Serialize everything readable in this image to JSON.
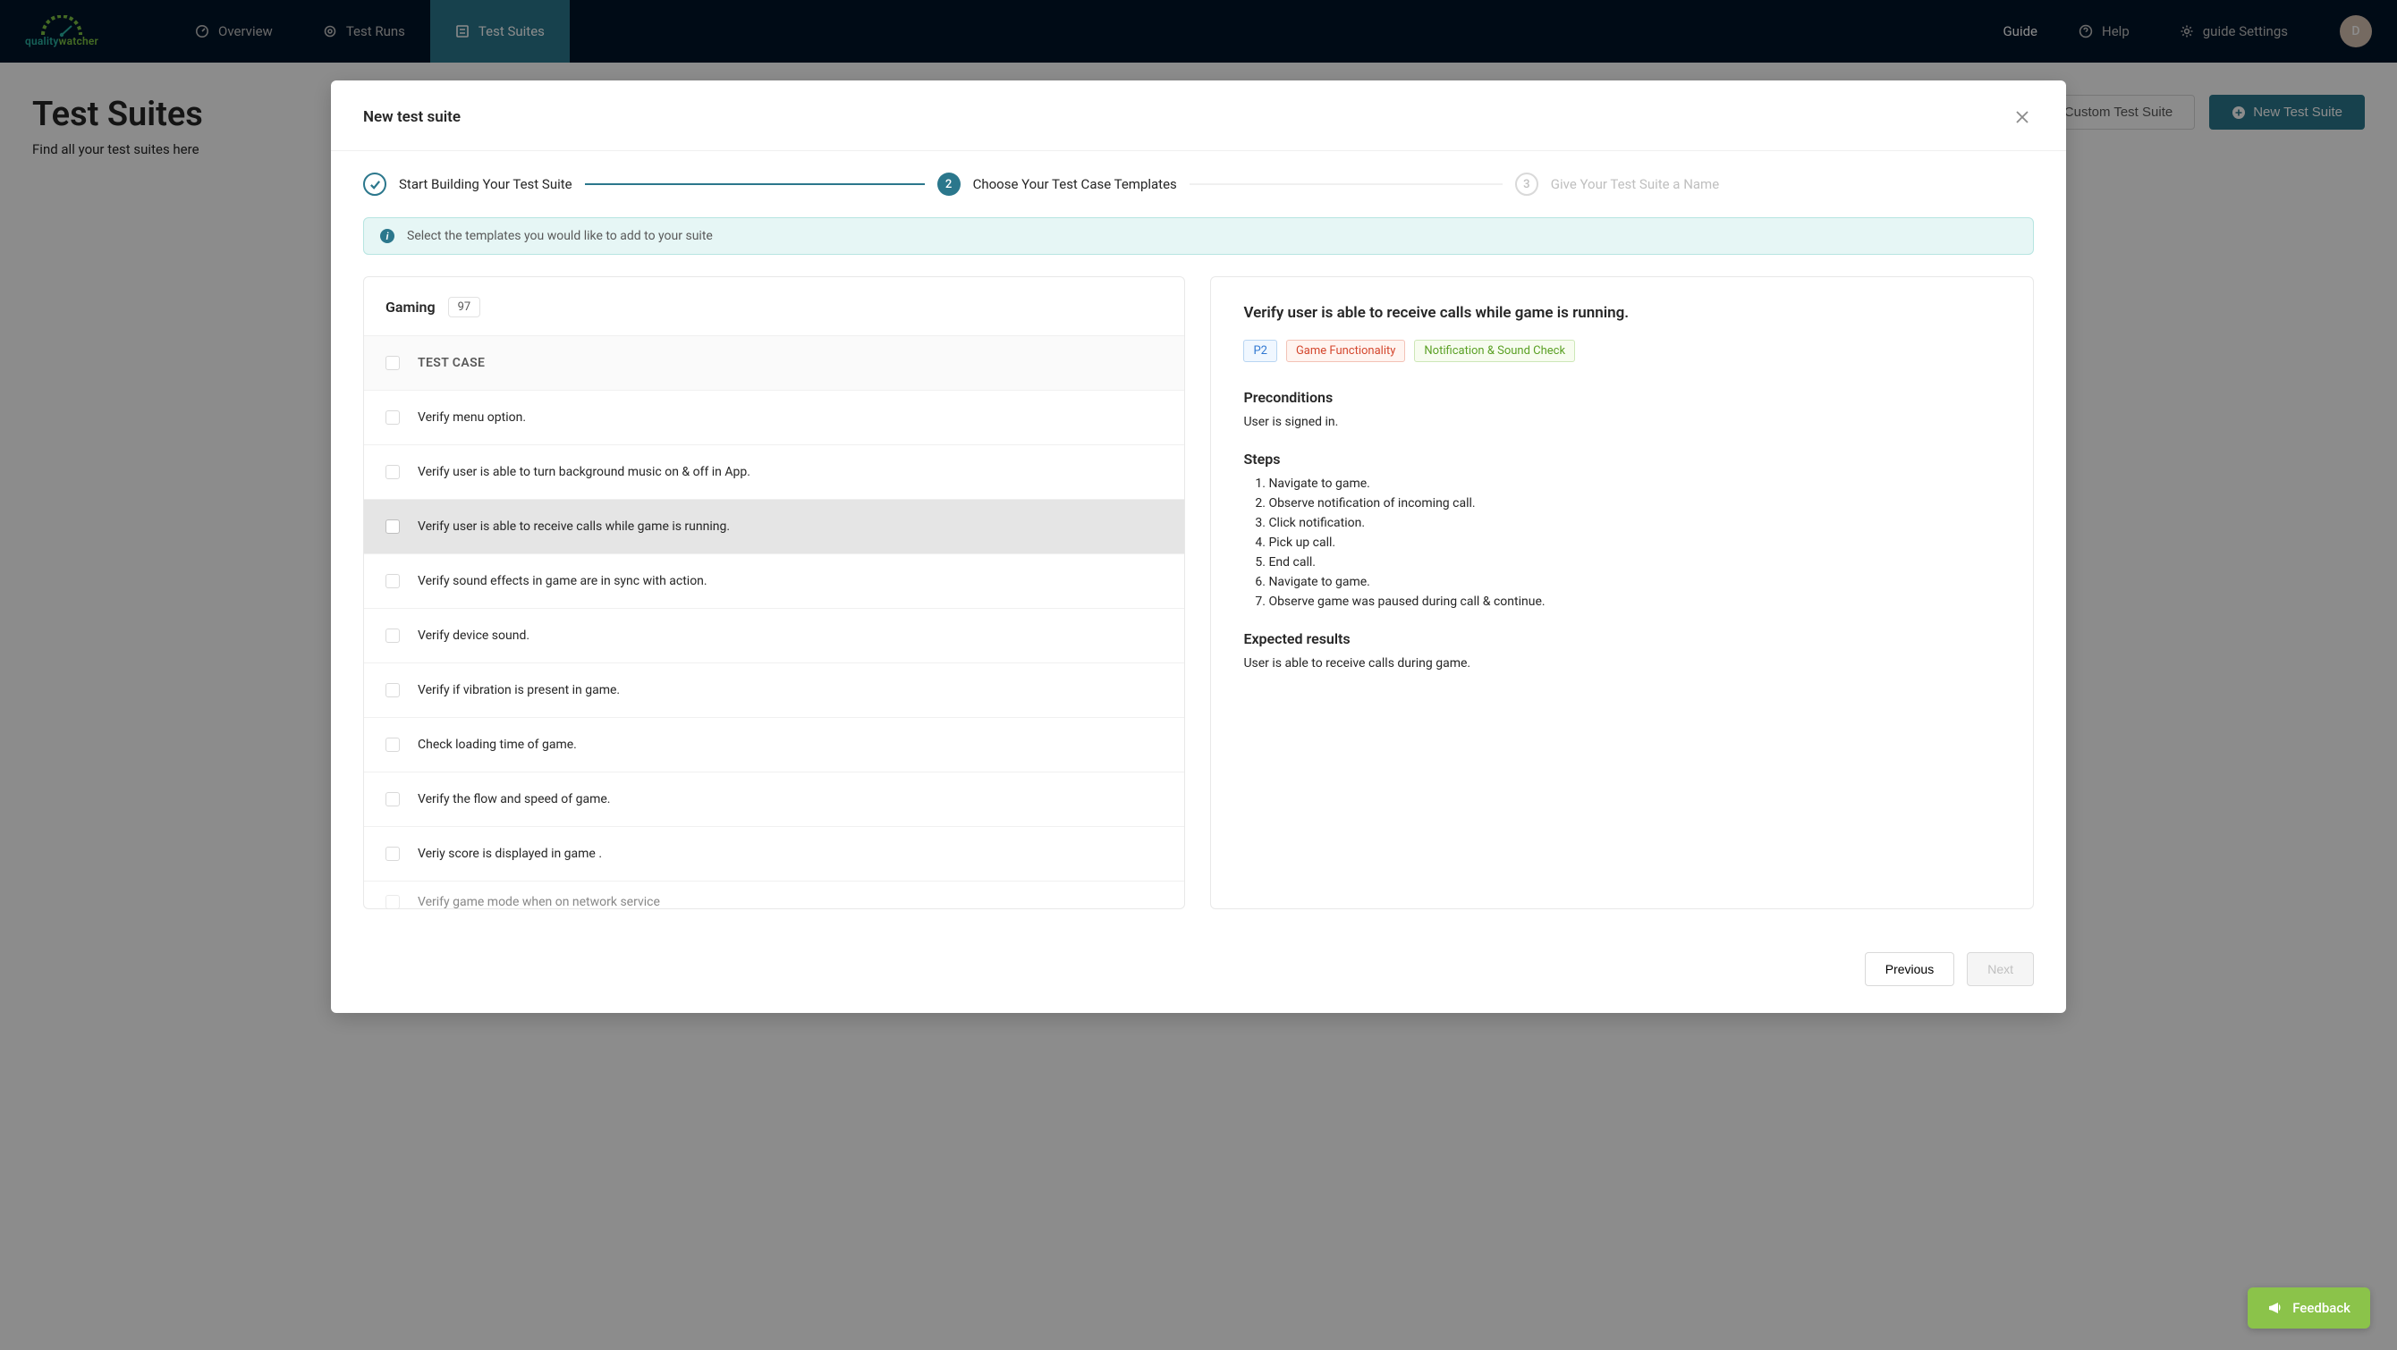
{
  "brand": {
    "name1": "quality",
    "name2": "watcher"
  },
  "nav": {
    "items": [
      {
        "label": "Overview",
        "active": false
      },
      {
        "label": "Test Runs",
        "active": false
      },
      {
        "label": "Test Suites",
        "active": true
      }
    ],
    "right": {
      "guide_label": "Guide",
      "help_label": "Help",
      "settings_label": "guide Settings",
      "avatar_initial": "D"
    }
  },
  "page": {
    "title": "Test Suites",
    "subtitle": "Find all your test suites here",
    "actions": {
      "custom_label": "Custom Test Suite",
      "new_label": "New Test Suite"
    }
  },
  "modal": {
    "title": "New test suite",
    "steps": [
      {
        "label": "Start Building Your Test Suite",
        "state": "done"
      },
      {
        "label": "Choose Your Test Case Templates",
        "state": "active",
        "num": "2"
      },
      {
        "label": "Give Your Test Suite a Name",
        "state": "pending",
        "num": "3"
      }
    ],
    "banner": "Select the templates you would like to add to your suite",
    "footer": {
      "prev": "Previous",
      "next": "Next"
    }
  },
  "category": {
    "name": "Gaming",
    "count": "97"
  },
  "table": {
    "header": "TEST CASE",
    "selected_index": 2,
    "rows": [
      "Verify menu option.",
      "Verify user is able to turn background music on & off in App.",
      "Verify user is able to receive calls while game is running.",
      "Verify sound effects in game are in sync with action.",
      "Verify device sound.",
      "Verify if vibration is present in game.",
      "Check loading time of game.",
      "Verify the flow and speed of game.",
      "Veriy score is displayed in game .",
      "Verify game mode when on network service"
    ]
  },
  "detail": {
    "title": "Verify user is able to receive calls while game is running.",
    "tags": [
      {
        "kind": "p2",
        "text": "P2"
      },
      {
        "kind": "red",
        "text": "Game Functionality"
      },
      {
        "kind": "green",
        "text": "Notification & Sound Check"
      }
    ],
    "pre_title": "Preconditions",
    "pre_body": "User is signed in.",
    "steps_title": "Steps",
    "steps": [
      "Navigate to game.",
      "Observe notification of incoming call.",
      "Click notification.",
      "Pick up call.",
      "End call.",
      "Navigate to game.",
      "Observe game was paused during call & continue."
    ],
    "exp_title": "Expected results",
    "exp_body": "User is able to receive calls during game."
  },
  "feedback_label": "Feedback"
}
